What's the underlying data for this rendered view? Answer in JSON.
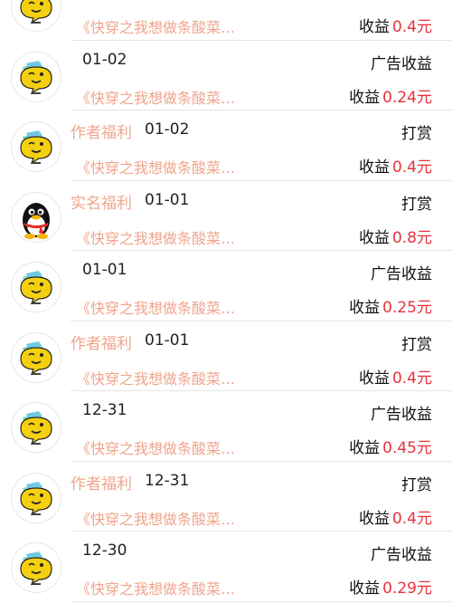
{
  "records": [
    {
      "avatar": "face-icon",
      "tag": "",
      "date": "",
      "type": "",
      "title": "《快穿之我想做条酸菜…",
      "income_label": "收益",
      "amount": "0.4元"
    },
    {
      "avatar": "face-icon",
      "tag": "",
      "date": "01-02",
      "type": "广告收益",
      "title": "《快穿之我想做条酸菜…",
      "income_label": "收益",
      "amount": "0.24元"
    },
    {
      "avatar": "face-icon",
      "tag": "作者福利",
      "date": "01-02",
      "type": "打赏",
      "title": "《快穿之我想做条酸菜…",
      "income_label": "收益",
      "amount": "0.4元"
    },
    {
      "avatar": "penguin-icon",
      "tag": "实名福利",
      "date": "01-01",
      "type": "打赏",
      "title": "《快穿之我想做条酸菜…",
      "income_label": "收益",
      "amount": "0.8元"
    },
    {
      "avatar": "face-icon",
      "tag": "",
      "date": "01-01",
      "type": "广告收益",
      "title": "《快穿之我想做条酸菜…",
      "income_label": "收益",
      "amount": "0.25元"
    },
    {
      "avatar": "face-icon",
      "tag": "作者福利",
      "date": "01-01",
      "type": "打赏",
      "title": "《快穿之我想做条酸菜…",
      "income_label": "收益",
      "amount": "0.4元"
    },
    {
      "avatar": "face-icon",
      "tag": "",
      "date": "12-31",
      "type": "广告收益",
      "title": "《快穿之我想做条酸菜…",
      "income_label": "收益",
      "amount": "0.45元"
    },
    {
      "avatar": "face-icon",
      "tag": "作者福利",
      "date": "12-31",
      "type": "打赏",
      "title": "《快穿之我想做条酸菜…",
      "income_label": "收益",
      "amount": "0.4元"
    },
    {
      "avatar": "face-icon",
      "tag": "",
      "date": "12-30",
      "type": "广告收益",
      "title": "《快穿之我想做条酸菜…",
      "income_label": "收益",
      "amount": "0.29元"
    }
  ],
  "colors": {
    "tag": "#f0a58c",
    "amount": "#e8323c",
    "divider": "#e5e5e5"
  }
}
